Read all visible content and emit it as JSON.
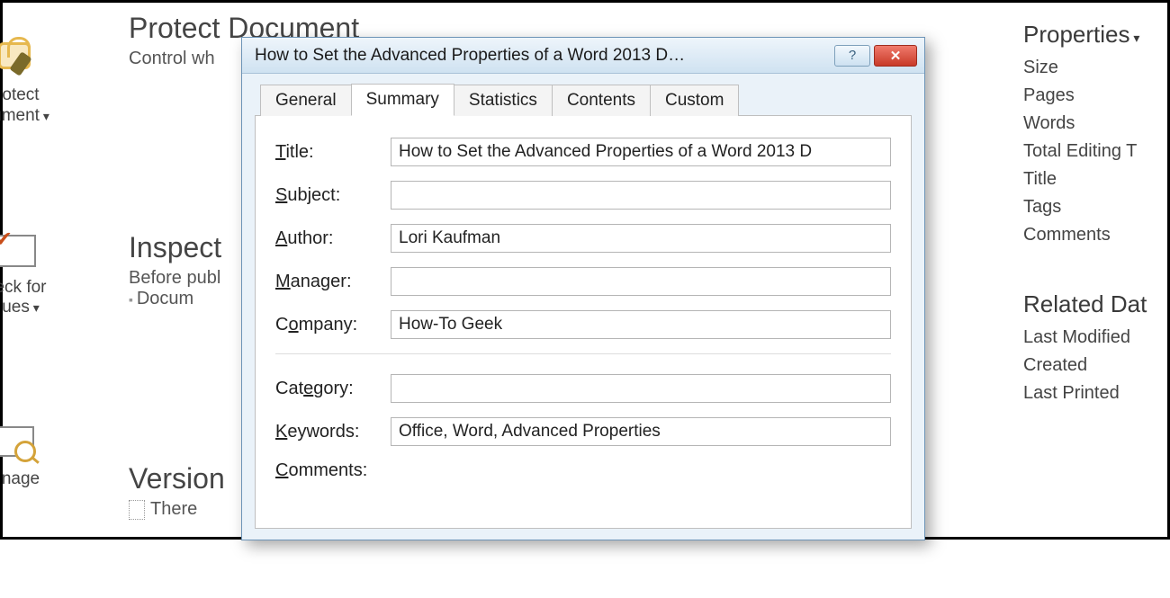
{
  "ribbon": {
    "protect_label": "otect\nument",
    "check_label": "eck for\nues",
    "manage_label": "nage"
  },
  "mid": {
    "protect_heading": "Protect Document",
    "protect_sub": "Control wh",
    "inspect_heading": "Inspect",
    "inspect_sub": "Before publ",
    "inspect_bullet": "Docum",
    "versions_heading": "Version",
    "versions_sub": "There"
  },
  "rightPanel": {
    "heading": "Properties",
    "items": [
      "Size",
      "Pages",
      "Words",
      "Total Editing T",
      "Title",
      "Tags",
      "Comments"
    ],
    "heading2": "Related Dat",
    "items2": [
      "Last Modified",
      "Created",
      "Last Printed"
    ]
  },
  "dialog": {
    "title": "How to Set the Advanced Properties of a Word 2013 D…",
    "tabs": [
      "General",
      "Summary",
      "Statistics",
      "Contents",
      "Custom"
    ],
    "activeTab": 1,
    "fields": {
      "title_label": "Title:",
      "title_value": "How to Set the Advanced Properties of a Word 2013 D",
      "subject_label": "Subject:",
      "subject_value": "",
      "author_label": "Author:",
      "author_value": "Lori Kaufman",
      "manager_label": "Manager:",
      "manager_value": "",
      "company_label": "Company:",
      "company_value": "How-To Geek",
      "category_label": "Category:",
      "category_value": "",
      "keywords_label": "Keywords:",
      "keywords_value": "Office, Word, Advanced Properties",
      "comments_label": "Comments:"
    }
  }
}
